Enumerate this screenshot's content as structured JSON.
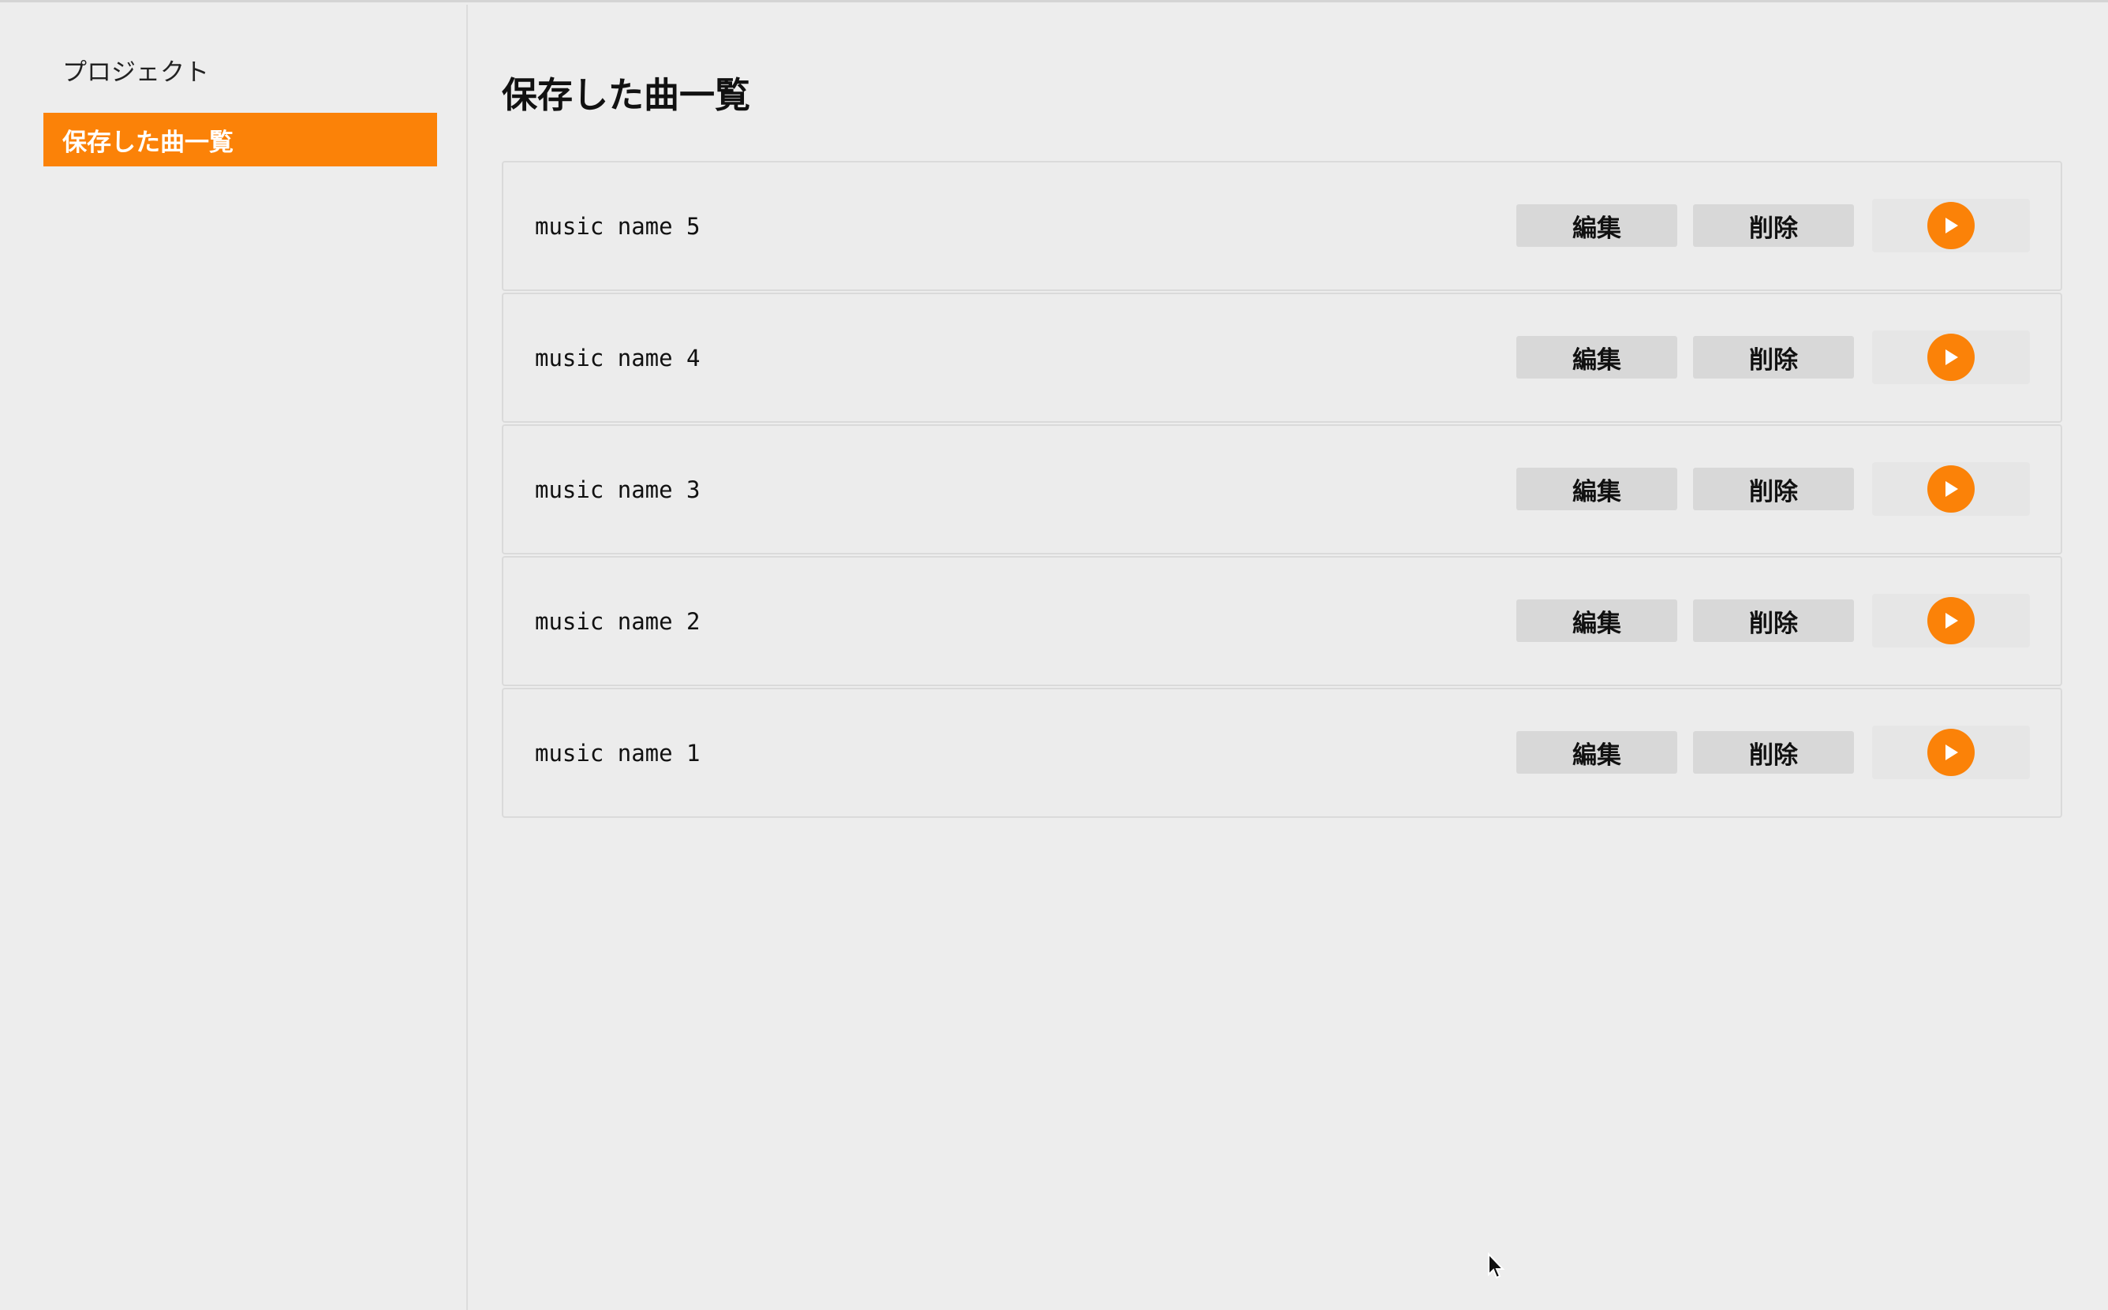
{
  "sidebar": {
    "items": [
      {
        "label": "プロジェクト",
        "active": false
      },
      {
        "label": "保存した曲一覧",
        "active": true
      }
    ]
  },
  "main": {
    "title": "保存した曲一覧",
    "songs": [
      {
        "name": "music name 5",
        "edit_label": "編集",
        "delete_label": "削除"
      },
      {
        "name": "music name 4",
        "edit_label": "編集",
        "delete_label": "削除"
      },
      {
        "name": "music name 3",
        "edit_label": "編集",
        "delete_label": "削除"
      },
      {
        "name": "music name 2",
        "edit_label": "編集",
        "delete_label": "削除"
      },
      {
        "name": "music name 1",
        "edit_label": "編集",
        "delete_label": "削除"
      }
    ],
    "play_icon": "play-icon"
  },
  "colors": {
    "accent": "#fb8208",
    "background": "#ededed",
    "button": "#d8d8d8"
  }
}
